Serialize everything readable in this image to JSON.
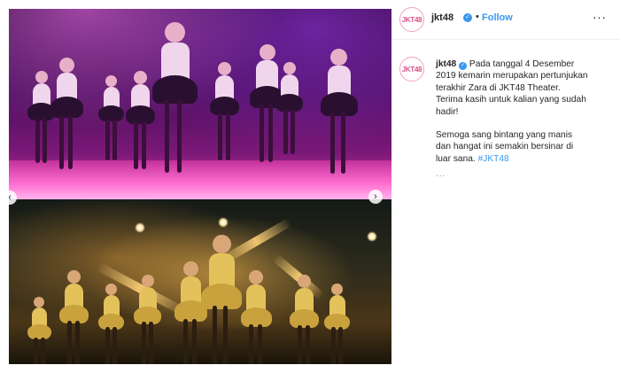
{
  "header": {
    "avatar_text": "JKT48",
    "username": "jkt48",
    "separator": "•",
    "follow_label": "Follow",
    "more_label": "···"
  },
  "media": {
    "prev_arrow": "‹",
    "next_arrow": "›"
  },
  "caption": {
    "avatar_text": "JKT48",
    "username": "jkt48",
    "paragraph1": "Pada tanggal 4 Desember 2019 kemarin merupakan pertunjukan terakhir Zara di JKT48 Theater. Terima kasih untuk kalian yang sudah hadir!",
    "paragraph2_text": "Semoga sang bintang yang manis dan hangat ini semakin bersinar di luar sana.",
    "hashtag": "#JKT48",
    "more": "..."
  },
  "colors": {
    "link_blue": "#3897f0",
    "text": "#262626",
    "muted": "#8e8e8e",
    "stage_magenta": "#d23aa2",
    "stage_amber": "#ffbe50"
  }
}
